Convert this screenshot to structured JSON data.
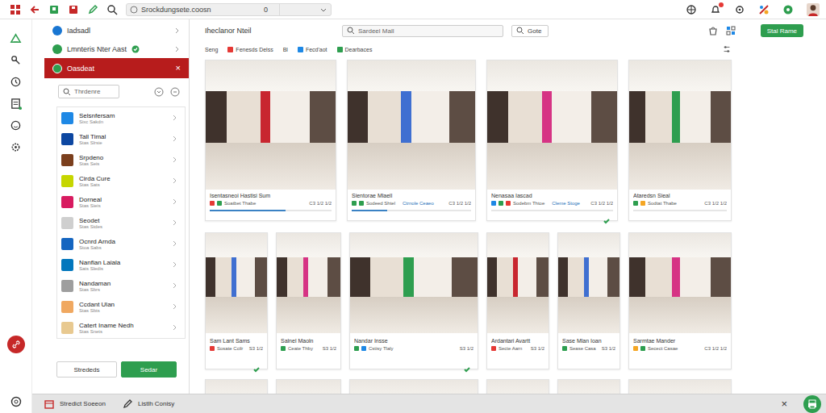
{
  "browser": {
    "address": "Srockdungsete.coosn",
    "address_count": "0"
  },
  "sidebar": {
    "top_items": [
      {
        "label": "Iadsadl",
        "color": "#1976d2",
        "selected": false,
        "verified": false
      },
      {
        "label": "Lmnteris Nter Aast",
        "color": "#2e9e4f",
        "selected": false,
        "verified": true
      },
      {
        "label": "Oasdeat",
        "color": "#2e9e4f",
        "selected": true,
        "verified": false,
        "close": "×"
      }
    ],
    "search": {
      "placeholder": "Thrdenre"
    },
    "items": [
      {
        "label": "Selsnfersam",
        "sub": "Sixc Sakdn",
        "color": "#1e88e5"
      },
      {
        "label": "Tall Timal",
        "sub": "Stas Slrsie",
        "color": "#0d47a1"
      },
      {
        "label": "Srpdeno",
        "sub": "Stas Seis",
        "color": "#7b3f1d"
      },
      {
        "label": "Cirda Cure",
        "sub": "Stas Sats",
        "color": "#c6d600"
      },
      {
        "label": "Dorneal",
        "sub": "Stas Sieis",
        "color": "#d81b60"
      },
      {
        "label": "Seodet",
        "sub": "Stas Stdes",
        "color": "#cfcfcf"
      },
      {
        "label": "Ocnrd Arnda",
        "sub": "Stoa Sabs",
        "color": "#1565c0"
      },
      {
        "label": "Nanfian Laiala",
        "sub": "Sats Sledis",
        "color": "#0277bd"
      },
      {
        "label": "Nandaman",
        "sub": "Stas Sbrs",
        "color": "#9e9e9e"
      },
      {
        "label": "Ccdant Ulan",
        "sub": "Stas Sbts",
        "color": "#f0a860"
      },
      {
        "label": "Catert Iname Nedh",
        "sub": "Stas Snets",
        "color": "#e8c990"
      }
    ],
    "buttons": [
      {
        "label": "Strededs",
        "primary": false
      },
      {
        "label": "Sedar",
        "primary": true
      }
    ]
  },
  "main": {
    "title": "Iheclanor Nteil",
    "search": {
      "placeholder": "Sardeel Mall"
    },
    "go": "Gote",
    "action": "Stal Rame",
    "filters": [
      {
        "label": "Seng"
      },
      {
        "label": "Fenesds Delss",
        "color": "#e53935"
      },
      {
        "label": "Bl"
      },
      {
        "label": "Fecd'aot",
        "color": "#1e88e5"
      },
      {
        "label": "Dearbaces",
        "color": "#2e9e4f"
      }
    ],
    "row1": [
      {
        "title": "Isentasneoi Hastisi Sum",
        "meta": "Soatbet Thabe",
        "stat": "C3 1/2 1/2",
        "level": 0.62,
        "verified": false,
        "badges": [
          "#e53935",
          "#2e9e4f"
        ]
      },
      {
        "title": "Sientorae Mlaell",
        "meta": "Sodeed Shtel",
        "tag": "Ctrnole Ceaeo",
        "stat": "C3 1/2 1/2",
        "level": 0.3,
        "verified": false,
        "badges": [
          "#2e9e4f",
          "#2e9e4f"
        ]
      },
      {
        "title": "Nenasaa Iascad",
        "meta": "Sodebm Thtoe",
        "tag": "Cleme Stoge",
        "stat": "C3 1/2 1/2",
        "level": 0,
        "verified": true,
        "badges": [
          "#1e88e5",
          "#2e9e4f",
          "#e53935"
        ]
      },
      {
        "title": "Ataredsn Sieal",
        "meta": "Sodtat Thabe",
        "stat": "C3 1/2 1/2",
        "level": 0,
        "verified": false,
        "badges": [
          "#2e9e4f",
          "#f5a623"
        ]
      }
    ],
    "row2": [
      {
        "title": "Sam Lant Sams",
        "meta": "Sosate Ccilr",
        "stat": "S3 1/2",
        "verified": true,
        "badges": [
          "#e53935"
        ]
      },
      {
        "title": "Salnel Maoln",
        "meta": "Ceate Thby",
        "stat": "S3 1/2",
        "verified": false,
        "badges": [
          "#2e9e4f"
        ]
      },
      {
        "title": "Nandar Insse",
        "meta": "Cstisy Tlaly",
        "stat": "S3 1/2",
        "verified": true,
        "badges": [
          "#2e9e4f",
          "#1e88e5"
        ]
      },
      {
        "title": "Ardantari Avartt",
        "meta": "Secte Aarn",
        "stat": "S3 1/2",
        "verified": false,
        "badges": [
          "#e53935"
        ]
      },
      {
        "title": "Sase Mlan Ioan",
        "meta": "Sease Casa",
        "stat": "S3 1/2",
        "verified": false,
        "badges": [
          "#2e9e4f"
        ]
      },
      {
        "title": "Sarmtae Mander",
        "meta": "Secect Casae",
        "stat": "C3 1/2 1/2",
        "verified": false,
        "badges": [
          "#f5a623",
          "#2e9e4f"
        ]
      }
    ]
  },
  "bottom_bar": {
    "items": [
      {
        "label": "Stredict Soeeon"
      },
      {
        "label": "Listlh Conisy"
      }
    ],
    "close": "×"
  }
}
